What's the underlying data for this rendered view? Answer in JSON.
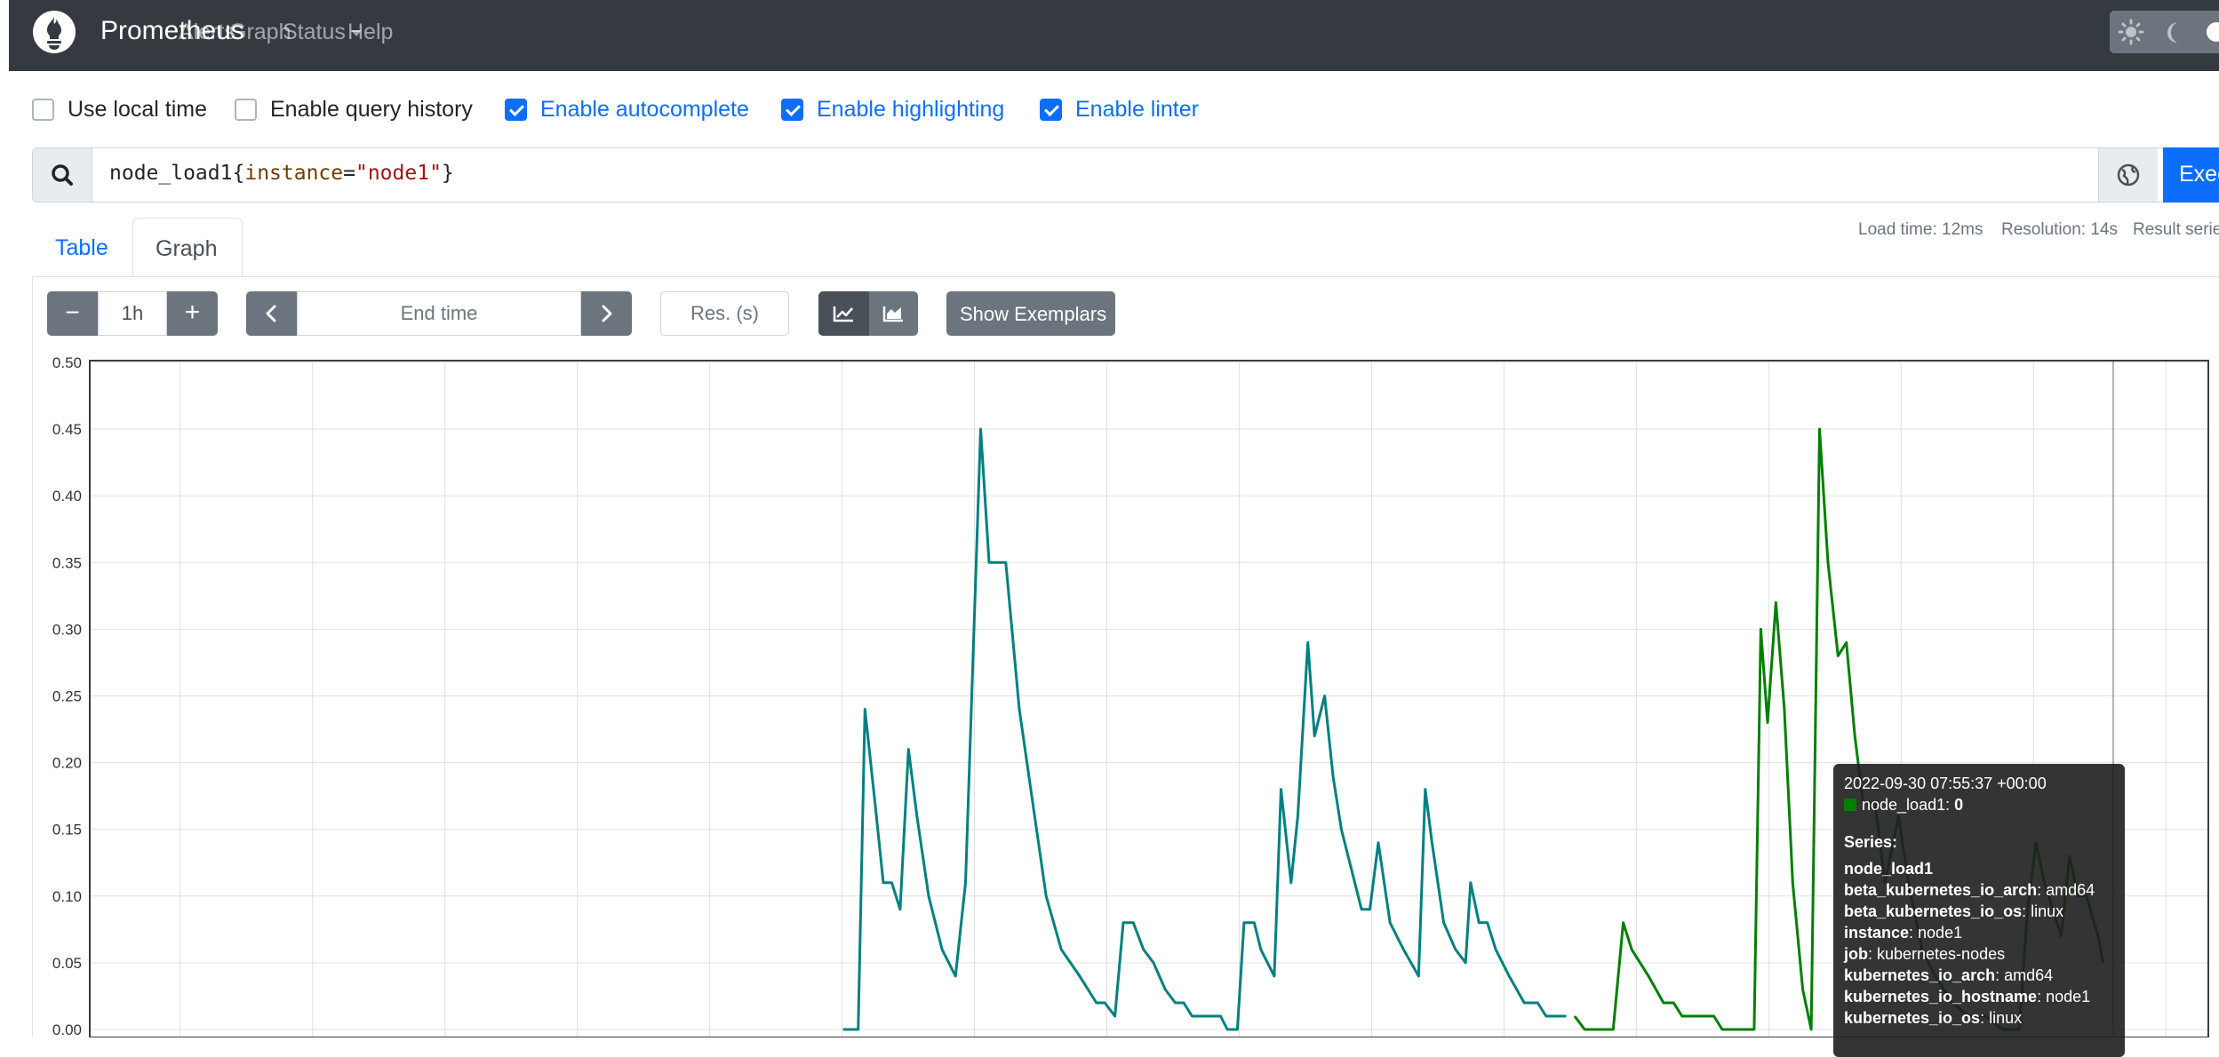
{
  "navbar": {
    "brand": "Prometheus",
    "links": [
      "Alerts",
      "Graph",
      "Status",
      "Help"
    ],
    "theme_icons": [
      "sun-icon",
      "moon-icon",
      "toggle-icon"
    ]
  },
  "options": [
    {
      "label": "Use local time",
      "checked": false
    },
    {
      "label": "Enable query history",
      "checked": false
    },
    {
      "label": "Enable autocomplete",
      "checked": true
    },
    {
      "label": "Enable highlighting",
      "checked": true
    },
    {
      "label": "Enable linter",
      "checked": true
    }
  ],
  "expression": {
    "metric": "node_load1",
    "label_name": "instance",
    "label_value": "\"node1\"",
    "execute_label": "Execute"
  },
  "tabs": [
    "Table",
    "Graph"
  ],
  "active_tab": "Graph",
  "stats": {
    "load_time": "Load time: 12ms",
    "resolution": "Resolution: 14s",
    "result_series": "Result series"
  },
  "controls": {
    "range": "1h",
    "end_time_placeholder": "End time",
    "resolution_placeholder": "Res. (s)",
    "show_exemplars": "Show Exemplars",
    "minus": "−",
    "plus": "+"
  },
  "tooltip": {
    "timestamp": "2022-09-30 07:55:37 +00:00",
    "series_name": "node_load1",
    "series_value": "0",
    "series_heading": "Series:",
    "metric_name": "node_load1",
    "labels": [
      {
        "key": "beta_kubernetes_io_arch",
        "value": "amd64"
      },
      {
        "key": "beta_kubernetes_io_os",
        "value": "linux"
      },
      {
        "key": "instance",
        "value": "node1"
      },
      {
        "key": "job",
        "value": "kubernetes-nodes"
      },
      {
        "key": "kubernetes_io_arch",
        "value": "amd64"
      },
      {
        "key": "kubernetes_io_hostname",
        "value": "node1"
      },
      {
        "key": "kubernetes_io_os",
        "value": "linux"
      }
    ]
  },
  "chart_data": {
    "type": "line",
    "ylim": [
      0,
      0.5
    ],
    "y_ticks": [
      "0.50",
      "0.45",
      "0.40",
      "0.35",
      "0.30",
      "0.25",
      "0.20",
      "0.15",
      "0.10",
      "0.05",
      "0.00"
    ],
    "grid": true,
    "colors": {
      "series_teal": "#008080",
      "series_green": "#008000"
    },
    "series": [
      {
        "values": [
          [
            0.449,
            0.0
          ],
          [
            0.458,
            0.0
          ],
          [
            0.462,
            0.24
          ],
          [
            0.468,
            0.17
          ],
          [
            0.473,
            0.11
          ],
          [
            0.478,
            0.11
          ],
          [
            0.483,
            0.09
          ],
          [
            0.488,
            0.21
          ],
          [
            0.493,
            0.16
          ],
          [
            0.5,
            0.1
          ],
          [
            0.508,
            0.06
          ],
          [
            0.516,
            0.04
          ],
          [
            0.522,
            0.11
          ],
          [
            0.531,
            0.45
          ],
          [
            0.536,
            0.35
          ],
          [
            0.546,
            0.35
          ],
          [
            0.554,
            0.24
          ],
          [
            0.562,
            0.17
          ],
          [
            0.57,
            0.1
          ],
          [
            0.579,
            0.06
          ],
          [
            0.59,
            0.04
          ],
          [
            0.6,
            0.02
          ],
          [
            0.605,
            0.02
          ],
          [
            0.611,
            0.01
          ],
          [
            0.616,
            0.08
          ],
          [
            0.622,
            0.08
          ],
          [
            0.628,
            0.06
          ],
          [
            0.634,
            0.05
          ],
          [
            0.641,
            0.03
          ],
          [
            0.647,
            0.02
          ],
          [
            0.652,
            0.02
          ],
          [
            0.657,
            0.01
          ],
          [
            0.674,
            0.01
          ],
          [
            0.678,
            0.0
          ],
          [
            0.684,
            0.0
          ],
          [
            0.688,
            0.08
          ],
          [
            0.694,
            0.08
          ],
          [
            0.698,
            0.06
          ],
          [
            0.706,
            0.04
          ],
          [
            0.71,
            0.18
          ],
          [
            0.716,
            0.11
          ],
          [
            0.72,
            0.16
          ],
          [
            0.726,
            0.29
          ],
          [
            0.73,
            0.22
          ],
          [
            0.736,
            0.25
          ],
          [
            0.741,
            0.19
          ],
          [
            0.746,
            0.15
          ],
          [
            0.758,
            0.09
          ],
          [
            0.763,
            0.09
          ],
          [
            0.768,
            0.14
          ],
          [
            0.775,
            0.08
          ],
          [
            0.783,
            0.06
          ],
          [
            0.792,
            0.04
          ],
          [
            0.796,
            0.18
          ],
          [
            0.8,
            0.14
          ],
          [
            0.807,
            0.08
          ],
          [
            0.814,
            0.06
          ],
          [
            0.82,
            0.05
          ],
          [
            0.823,
            0.11
          ],
          [
            0.828,
            0.08
          ],
          [
            0.833,
            0.08
          ],
          [
            0.838,
            0.06
          ],
          [
            0.846,
            0.04
          ],
          [
            0.855,
            0.02
          ],
          [
            0.863,
            0.02
          ],
          [
            0.868,
            0.01
          ],
          [
            0.88,
            0.01
          ]
        ]
      },
      {
        "values": [
          [
            0.885,
            0.01
          ],
          [
            0.891,
            0.0
          ],
          [
            0.908,
            0.0
          ],
          [
            0.914,
            0.08
          ],
          [
            0.919,
            0.06
          ],
          [
            0.929,
            0.04
          ],
          [
            0.938,
            0.02
          ],
          [
            0.944,
            0.02
          ],
          [
            0.949,
            0.01
          ],
          [
            0.968,
            0.01
          ],
          [
            0.973,
            0.0
          ],
          [
            0.992,
            0.0
          ],
          [
            0.996,
            0.3
          ],
          [
            1.0,
            0.23
          ],
          [
            1.005,
            0.32
          ],
          [
            1.01,
            0.24
          ],
          [
            1.015,
            0.11
          ],
          [
            1.021,
            0.03
          ],
          [
            1.026,
            0.0
          ],
          [
            1.031,
            0.45
          ],
          [
            1.036,
            0.35
          ],
          [
            1.042,
            0.28
          ],
          [
            1.047,
            0.29
          ],
          [
            1.052,
            0.22
          ],
          [
            1.057,
            0.17
          ],
          [
            1.064,
            0.17
          ],
          [
            1.07,
            0.11
          ],
          [
            1.078,
            0.16
          ],
          [
            1.084,
            0.11
          ],
          [
            1.092,
            0.06
          ],
          [
            1.1,
            0.04
          ],
          [
            1.11,
            0.02
          ],
          [
            1.12,
            0.01
          ],
          [
            1.13,
            0.01
          ],
          [
            1.14,
            0.0
          ],
          [
            1.15,
            0.0
          ],
          [
            1.155,
            0.09
          ],
          [
            1.16,
            0.14
          ],
          [
            1.165,
            0.11
          ],
          [
            1.175,
            0.07
          ],
          [
            1.18,
            0.13
          ],
          [
            1.185,
            0.1
          ],
          [
            1.19,
            0.1
          ],
          [
            1.197,
            0.07
          ],
          [
            1.2,
            0.05
          ]
        ]
      }
    ]
  }
}
